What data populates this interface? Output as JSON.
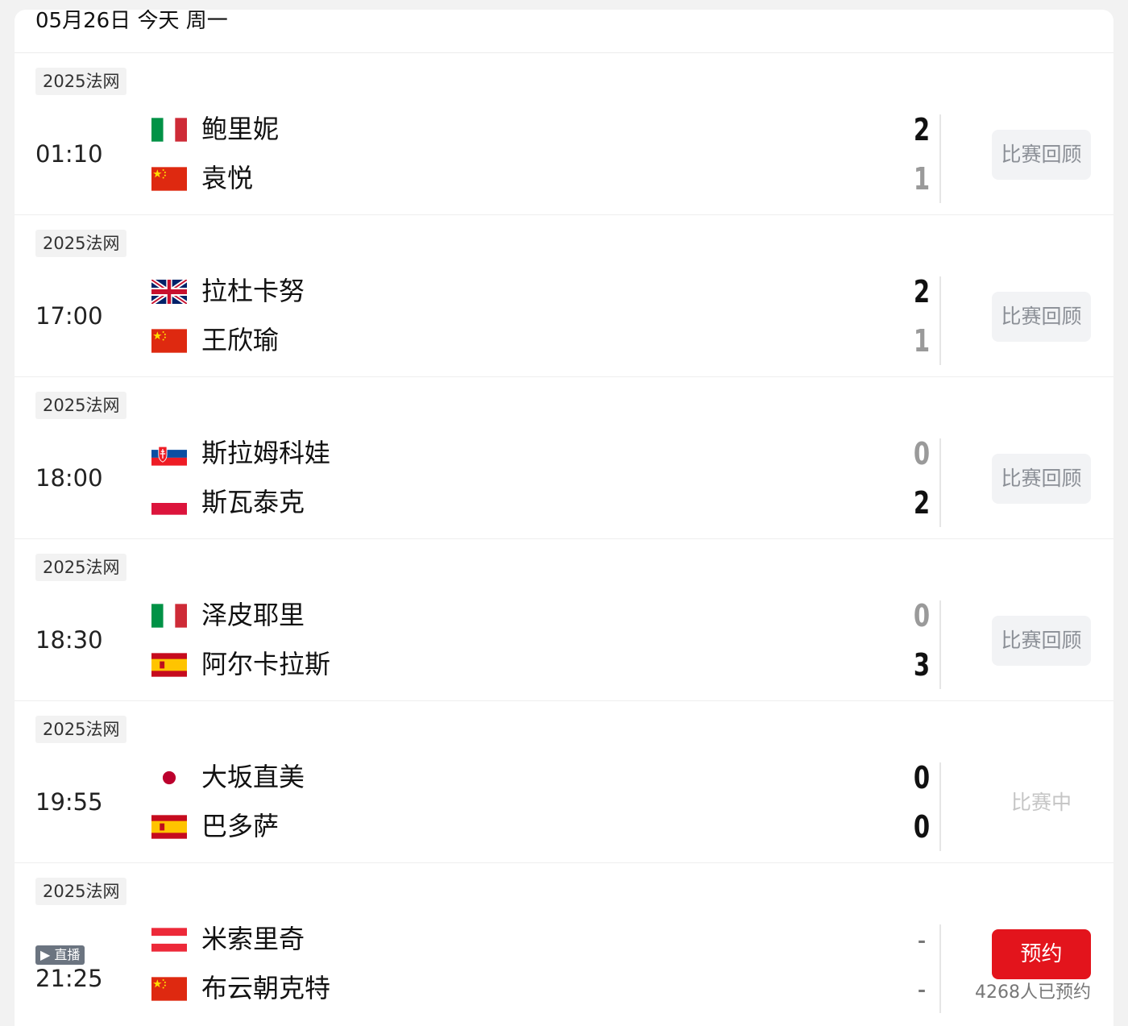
{
  "header": {
    "date": "05月26日",
    "today": "今天",
    "weekday": "周一"
  },
  "actions": {
    "replay_label": "比赛回顾",
    "inplay_label": "比赛中",
    "reserve_label": "预约",
    "live_label": "▶ 直播"
  },
  "matches": [
    {
      "tournament": "2025法网",
      "time": "01:10",
      "p1": {
        "name": "鲍里妮",
        "flag": "italy-flag",
        "score": "2"
      },
      "p2": {
        "name": "袁悦",
        "flag": "china-flag",
        "score": "1"
      },
      "status": "finished"
    },
    {
      "tournament": "2025法网",
      "time": "17:00",
      "p1": {
        "name": "拉杜卡努",
        "flag": "uk-flag",
        "score": "2"
      },
      "p2": {
        "name": "王欣瑜",
        "flag": "china-flag",
        "score": "1"
      },
      "status": "finished"
    },
    {
      "tournament": "2025法网",
      "time": "18:00",
      "p1": {
        "name": "斯拉姆科娃",
        "flag": "slovakia-flag",
        "score": "0"
      },
      "p2": {
        "name": "斯瓦泰克",
        "flag": "poland-flag",
        "score": "2"
      },
      "status": "finished"
    },
    {
      "tournament": "2025法网",
      "time": "18:30",
      "p1": {
        "name": "泽皮耶里",
        "flag": "italy-flag",
        "score": "0"
      },
      "p2": {
        "name": "阿尔卡拉斯",
        "flag": "spain-flag",
        "score": "3"
      },
      "status": "finished"
    },
    {
      "tournament": "2025法网",
      "time": "19:55",
      "p1": {
        "name": "大坂直美",
        "flag": "japan-flag",
        "score": "0"
      },
      "p2": {
        "name": "巴多萨",
        "flag": "spain-flag",
        "score": "0"
      },
      "status": "in-play"
    },
    {
      "tournament": "2025法网",
      "time": "21:25",
      "p1": {
        "name": "米索里奇",
        "flag": "austria-flag",
        "score": "-"
      },
      "p2": {
        "name": "布云朝克特",
        "flag": "china-flag",
        "score": "-"
      },
      "status": "upcoming",
      "live": true,
      "reserve_count": "4268人已预约"
    }
  ]
}
